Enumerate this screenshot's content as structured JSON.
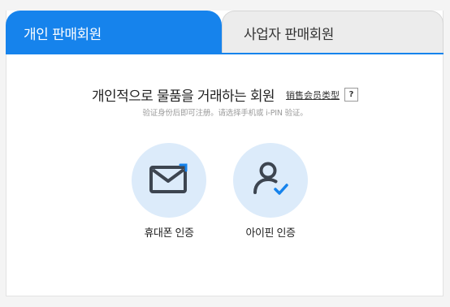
{
  "tabs": {
    "individual_label": "개인 판매회원",
    "business_label": "사업자 판매회원"
  },
  "headline": {
    "title": "개인적으로 물품을 거래하는 회원",
    "link": "销售会员类型",
    "help": "?"
  },
  "subtext": "验证身份后即可注册。请选择手机或 i-PIN 验证。",
  "options": {
    "phone_label": "휴대폰 인증",
    "ipin_label": "아이핀 인증"
  },
  "icons": {
    "phone": "envelope-icon",
    "ipin": "user-check-icon"
  },
  "colors": {
    "accent": "#1683ec",
    "circle_bg": "#dcebfa",
    "icon_dark": "#3d4550"
  }
}
